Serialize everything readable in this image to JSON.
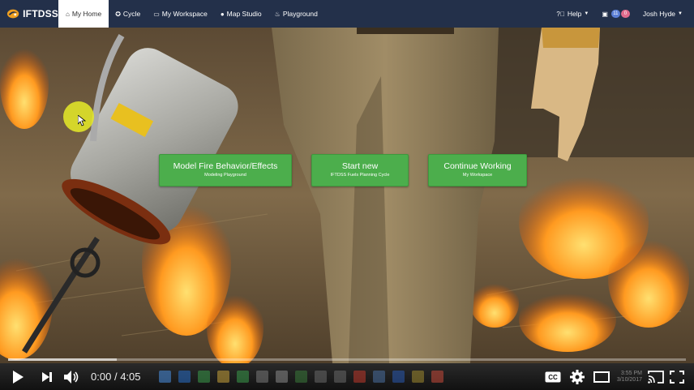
{
  "app": {
    "brand": "IFTDSS",
    "nav": [
      {
        "label": "My Home",
        "icon": "home-icon",
        "glyph": "⌂",
        "active": true
      },
      {
        "label": "Cycle",
        "icon": "cycle-icon",
        "glyph": "✪",
        "active": false
      },
      {
        "label": "My Workspace",
        "icon": "workspace-icon",
        "glyph": "▭",
        "active": false
      },
      {
        "label": "Map Studio",
        "icon": "map-marker-icon",
        "glyph": "●",
        "active": false
      },
      {
        "label": "Playground",
        "icon": "flame-icon",
        "glyph": "♨",
        "active": false
      }
    ],
    "help_label": "Help",
    "notifications": {
      "count_primary": "11",
      "count_secondary": "0"
    },
    "user_name": "Josh Hyde"
  },
  "hero": {
    "buttons": [
      {
        "main": "Model Fire Behavior/Effects",
        "sub": "Modeling Playground"
      },
      {
        "main": "Start new",
        "sub": "IFTDSS Fuels Planning Cycle"
      },
      {
        "main": "Continue Working",
        "sub": "My Workspace"
      }
    ]
  },
  "player": {
    "time_current": "0:00",
    "time_separator": "/",
    "time_total": "4:05",
    "progress_played": 0.0,
    "progress_loaded": 0.16,
    "clock_time": "3:55 PM",
    "clock_date": "3/10/2017",
    "colors": {
      "played": "#ee0000",
      "button_green": "#4cae4c",
      "navbar": "#23304a"
    }
  }
}
